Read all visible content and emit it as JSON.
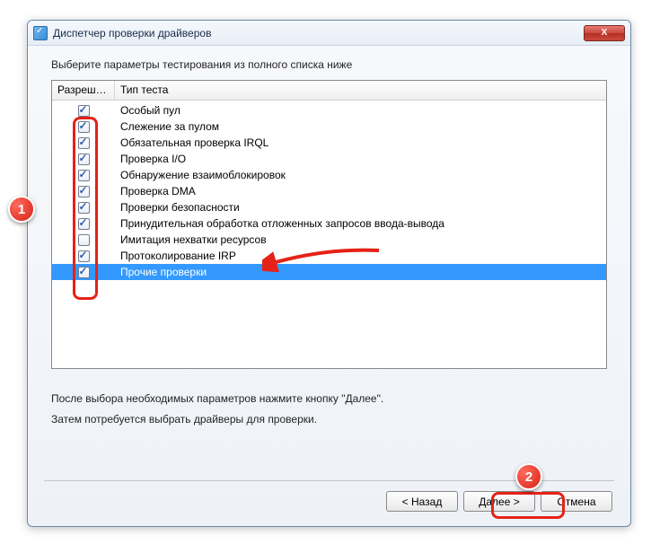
{
  "window": {
    "title": "Диспетчер проверки драйверов",
    "close": "X"
  },
  "instruction": "Выберите параметры тестирования из полного списка ниже",
  "columns": {
    "allow": "Разреше...",
    "type": "Тип теста"
  },
  "tests": [
    {
      "label": "Особый пул",
      "checked": true
    },
    {
      "label": "Слежение за пулом",
      "checked": true
    },
    {
      "label": "Обязательная проверка IRQL",
      "checked": true
    },
    {
      "label": "Проверка I/O",
      "checked": true
    },
    {
      "label": "Обнаружение взаимоблокировок",
      "checked": true
    },
    {
      "label": "Проверка DMA",
      "checked": true
    },
    {
      "label": "Проверки безопасности",
      "checked": true
    },
    {
      "label": "Принудительная обработка отложенных запросов ввода-вывода",
      "checked": true
    },
    {
      "label": "Имитация нехватки ресурсов",
      "checked": false
    },
    {
      "label": "Протоколирование IRP",
      "checked": true
    },
    {
      "label": "Прочие проверки",
      "checked": true,
      "selected": true
    }
  ],
  "hint1": "После выбора необходимых параметров нажмите кнопку \"Далее\".",
  "hint2": "Затем потребуется выбрать драйверы для проверки.",
  "buttons": {
    "back": "< Назад",
    "next": "Далее >",
    "cancel": "Отмена"
  },
  "markers": {
    "one": "1",
    "two": "2"
  }
}
